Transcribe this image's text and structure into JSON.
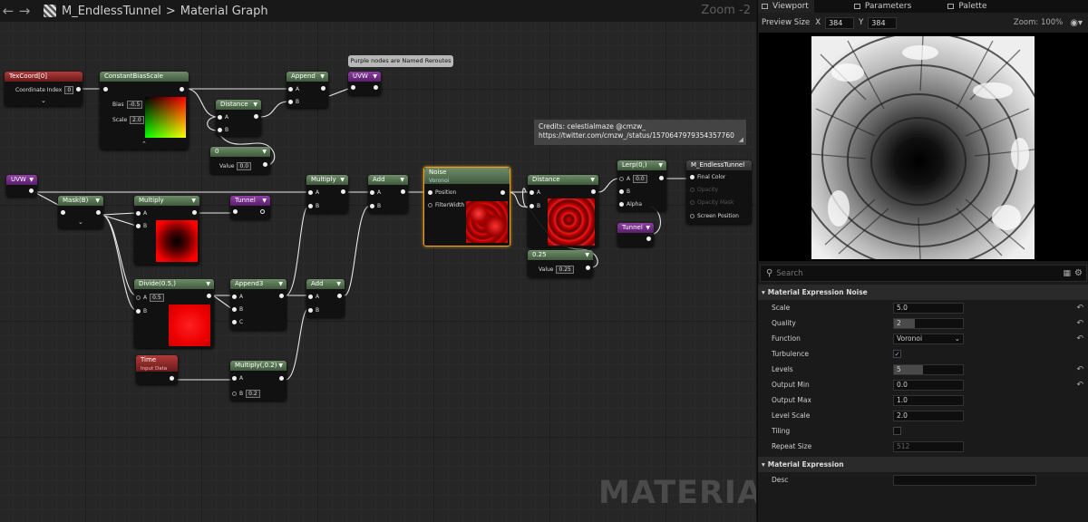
{
  "topbar": {
    "asset": "M_EndlessTunnel",
    "separator": ">",
    "graph": "Material Graph",
    "zoom": "Zoom -2"
  },
  "nodes": {
    "texcoord": {
      "title": "TexCoord[0]",
      "pin": "Coordinate Index",
      "val": "0"
    },
    "cbs": {
      "title": "ConstantBiasScale",
      "bias_lbl": "Bias",
      "bias": "-0.5",
      "scale_lbl": "Scale",
      "scale": "2.0"
    },
    "append1": {
      "title": "Append",
      "a": "A",
      "b": "B"
    },
    "uvw_r": {
      "title": "UVW"
    },
    "distance1": {
      "title": "Distance",
      "a": "A",
      "b": "B"
    },
    "const0": {
      "title": "0",
      "pin": "Value",
      "val": "0.0"
    },
    "uvw2": {
      "title": "UVW"
    },
    "mask": {
      "title": "Mask(B)"
    },
    "multiply1": {
      "title": "Multiply",
      "a": "A",
      "b": "B"
    },
    "tunnel1": {
      "title": "Tunnel"
    },
    "multiply2": {
      "title": "Multiply",
      "a": "A",
      "b": "B"
    },
    "add1": {
      "title": "Add",
      "a": "A",
      "b": "B"
    },
    "noise": {
      "title": "Noise",
      "subtitle": "Voronoi",
      "pos": "Position",
      "fw": "FilterWidth"
    },
    "distance2": {
      "title": "Distance",
      "a": "A",
      "b": "B"
    },
    "const25": {
      "title": "0.25",
      "pin": "Value",
      "val": "0.25"
    },
    "lerp": {
      "title": "Lerp(0,)",
      "a": "A",
      "aval": "0.0",
      "b": "B",
      "alpha": "Alpha"
    },
    "tunnel2": {
      "title": "Tunnel"
    },
    "result": {
      "title": "M_EndlessTunnel",
      "final": "Final Color",
      "opacity": "Opacity",
      "omask": "Opacity Mask",
      "spos": "Screen Position"
    },
    "divide": {
      "title": "Divide(0.5,)",
      "a": "A",
      "aval": "0.5",
      "b": "B"
    },
    "append3": {
      "title": "Append3",
      "a": "A",
      "b": "B",
      "c": "C"
    },
    "add2": {
      "title": "Add",
      "a": "A",
      "b": "B"
    },
    "time": {
      "title": "Time",
      "subtitle": "Input Data"
    },
    "multiply3": {
      "title": "Multiply(,0.2)",
      "a": "A",
      "b": "B",
      "bval": "0.2"
    }
  },
  "note": "Purple nodes are Named Reroutes",
  "credits": {
    "line1": "Credits:  celestialmaze @cmzw_",
    "line2": "https://twitter.com/cmzw_/status/1570647979354357760"
  },
  "watermark": "MATERIAL",
  "panel": {
    "tabs": [
      "Viewport",
      "Parameters",
      "Palette"
    ],
    "preview_label": "Preview Size",
    "x_label": "X",
    "x_val": "384",
    "y_label": "Y",
    "y_val": "384",
    "zoom": "Zoom: 100%",
    "search_placeholder": "Search",
    "section1": "Material Expression Noise",
    "props": [
      {
        "label": "Scale",
        "value": "5.0"
      },
      {
        "label": "Quality",
        "value": "2",
        "fill": 0.3
      },
      {
        "label": "Function",
        "value": "Voronoi"
      },
      {
        "label": "Turbulence",
        "checked": true
      },
      {
        "label": "Levels",
        "value": "5",
        "fill": 0.42
      },
      {
        "label": "Output Min",
        "value": "0.0"
      },
      {
        "label": "Output Max",
        "value": "1.0"
      },
      {
        "label": "Level Scale",
        "value": "2.0"
      },
      {
        "label": "Tiling",
        "checked": false
      },
      {
        "label": "Repeat Size",
        "value": "512"
      }
    ],
    "section2": "Material Expression",
    "desc_label": "Desc",
    "desc_value": ""
  }
}
